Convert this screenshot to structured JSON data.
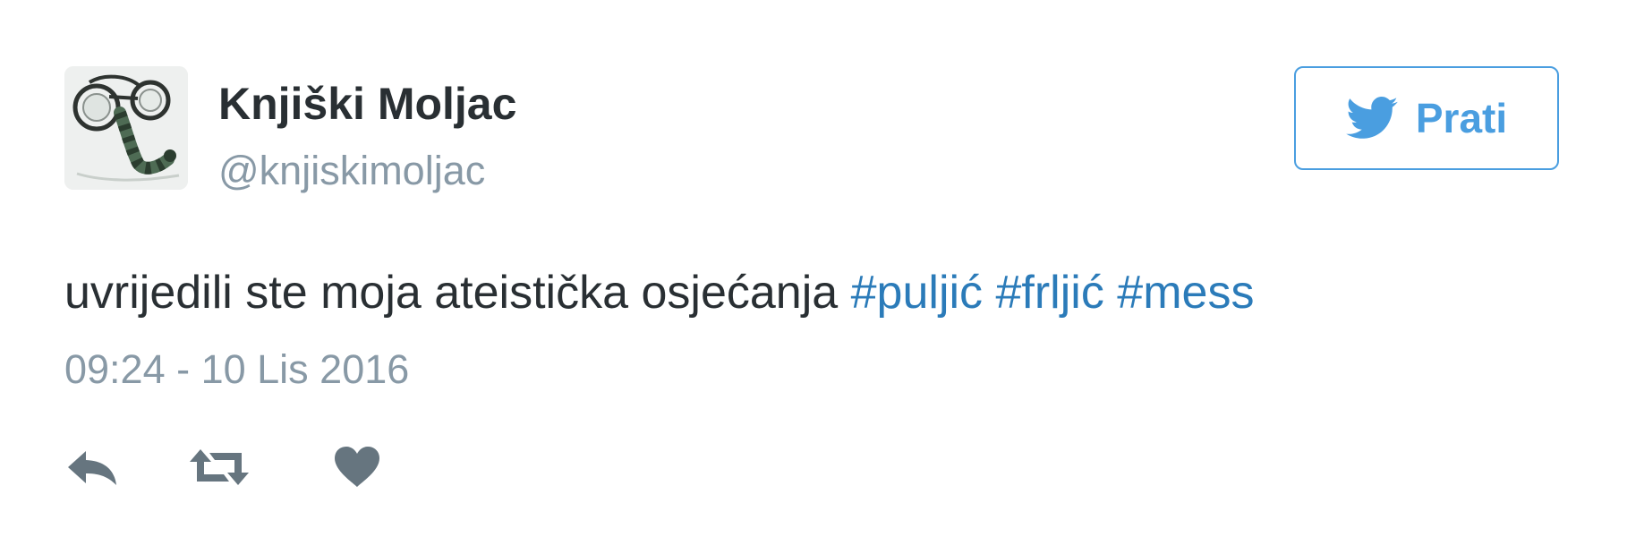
{
  "tweet": {
    "author": {
      "name": "Knjiški Moljac",
      "handle": "@knjiskimoljac",
      "avatar_icon": "bookworm-bicycle-avatar"
    },
    "follow_button": {
      "label": "Prati",
      "icon": "twitter-bird-icon",
      "color": "#4a9ee0"
    },
    "text": {
      "body": "uvrijedili ste moja ateistička osjećanja",
      "hashtags": [
        "#puljić",
        "#frljić",
        "#mess"
      ]
    },
    "timestamp": "09:24 - 10 Lis 2016",
    "actions": [
      {
        "name": "reply",
        "icon": "reply-icon"
      },
      {
        "name": "retweet",
        "icon": "retweet-icon"
      },
      {
        "name": "like",
        "icon": "heart-icon"
      }
    ],
    "colors": {
      "text": "#292f33",
      "muted": "#8899a6",
      "link": "#2b7bb9",
      "action_icon": "#66757f"
    }
  }
}
